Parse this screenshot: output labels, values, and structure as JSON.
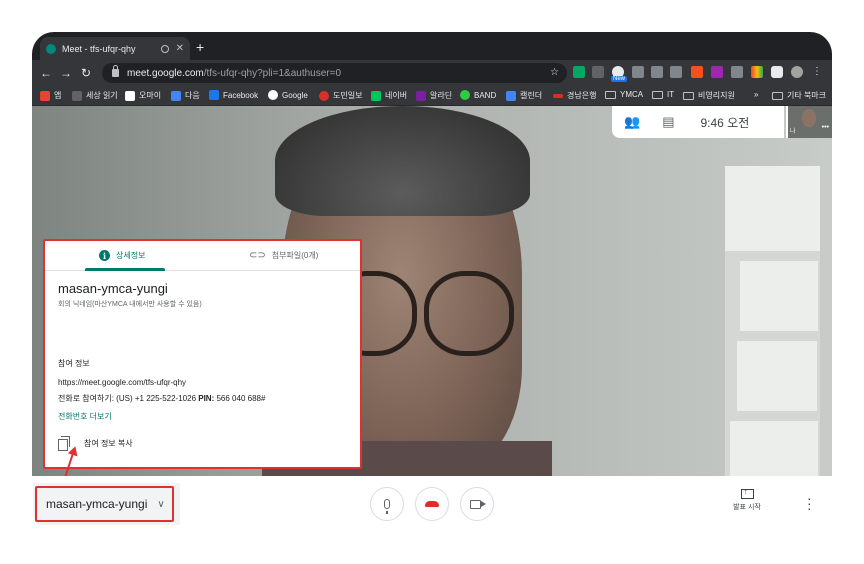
{
  "browser": {
    "tab_title": "Meet - tfs-ufqr-qhy",
    "tab_close": "✕",
    "new_tab": "+",
    "url_host": "meet.google.com",
    "url_path": "/tfs-ufqr-qhy?pli=1&authuser=0",
    "new_badge": "New",
    "nav": {
      "back": "←",
      "forward": "→",
      "reload": "↻"
    }
  },
  "bookmarks": {
    "items": [
      {
        "label": "앱",
        "color": "#ea4335"
      },
      {
        "label": "세상 읽기",
        "color": "#5f6368"
      },
      {
        "label": "오마이",
        "color": "#ffffff"
      },
      {
        "label": "다음",
        "color": "#4285f4"
      },
      {
        "label": "Facebook",
        "color": "#1877f2"
      },
      {
        "label": "Google",
        "color": "#ffffff"
      },
      {
        "label": "도민일보",
        "color": "#d93025"
      },
      {
        "label": "네이버",
        "color": "#03c75a"
      },
      {
        "label": "알라딘",
        "color": "#7b1fa2"
      },
      {
        "label": "BAND",
        "color": "#2ecc40"
      },
      {
        "label": "캘린더",
        "color": "#4285f4"
      },
      {
        "label": "경남은행",
        "color": "#d93025"
      },
      {
        "label": "YMCA",
        "color": "folder"
      },
      {
        "label": "IT",
        "color": "folder"
      },
      {
        "label": "비영리지원",
        "color": "folder"
      }
    ],
    "overflow": "»",
    "other": "기타 북마크"
  },
  "meet": {
    "clock": "9:46 오전",
    "self_label": "나",
    "panel": {
      "tab_details": "상세정보",
      "tab_attachments": "첨부파일(0개)",
      "meeting_name": "masan-ymca-yungi",
      "meeting_sub": "회의 닉네임(마산YMCA 내에서만 사용할 수 있음)",
      "join_heading": "참여 정보",
      "join_url": "https://meet.google.com/tfs-ufqr-qhy",
      "phone_prefix": "전화로 참여하기: (US) +1 225-522-1026",
      "pin_label": "PIN:",
      "pin_value": "566 040 688#",
      "more_phones": "전화번호 더보기",
      "copy_label": "참여 정보 복사"
    },
    "bottom": {
      "meeting_name": "masan-ymca-yungi",
      "present_label": "발표 시작"
    }
  }
}
